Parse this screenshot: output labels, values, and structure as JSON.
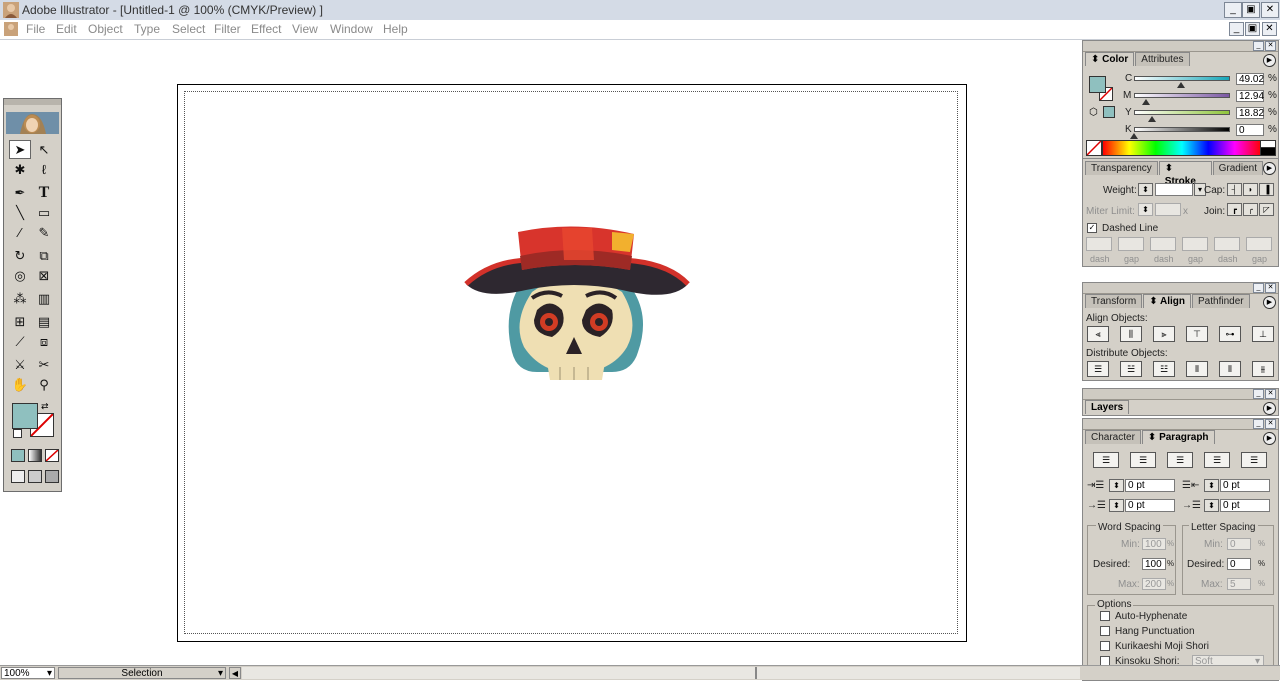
{
  "window": {
    "title": "Adobe Illustrator - [Untitled-1 @ 100% (CMYK/Preview) ]",
    "minimize": "_",
    "restore": "▣",
    "close": "✕"
  },
  "menu": [
    "File",
    "Edit",
    "Object",
    "Type",
    "Select",
    "Filter",
    "Effect",
    "View",
    "Window",
    "Help"
  ],
  "color_palette": {
    "tabs": [
      "Color",
      "Attributes"
    ],
    "active_tab": "Color",
    "channels": [
      {
        "label": "C",
        "value": "49.02",
        "unit": "%",
        "level": 0.49,
        "gradient_end": "#16a6b8"
      },
      {
        "label": "M",
        "value": "12.94",
        "unit": "%",
        "level": 0.13,
        "gradient_end": "#7b57a3"
      },
      {
        "label": "Y",
        "value": "18.82",
        "unit": "%",
        "level": 0.19,
        "gradient_end": "#8fc43b"
      },
      {
        "label": "K",
        "value": "0",
        "unit": "%",
        "level": 0.0,
        "gradient_end": "#000000"
      }
    ],
    "fill_color": "#8fc0bf"
  },
  "stroke_palette": {
    "tabs": [
      "Transparency",
      "Stroke",
      "Gradient"
    ],
    "active_tab": "Stroke",
    "weight_label": "Weight:",
    "cap_label": "Cap:",
    "miter_label": "Miter Limit:",
    "miter_unit": "x",
    "join_label": "Join:",
    "dashed_label": "Dashed Line",
    "dash_labels": [
      "dash",
      "gap",
      "dash",
      "gap",
      "dash",
      "gap"
    ]
  },
  "align_palette": {
    "tabs": [
      "Transform",
      "Align",
      "Pathfinder"
    ],
    "active_tab": "Align",
    "align_label": "Align Objects:",
    "distribute_label": "Distribute Objects:"
  },
  "layers_palette": {
    "title": "Layers"
  },
  "paragraph_palette": {
    "tabs": [
      "Character",
      "Paragraph"
    ],
    "active_tab": "Paragraph",
    "indents": [
      {
        "name": "left-indent",
        "value": "0 pt"
      },
      {
        "name": "right-indent",
        "value": "0 pt"
      },
      {
        "name": "first-line-indent",
        "value": "0 pt"
      },
      {
        "name": "space-before",
        "value": "0 pt"
      }
    ],
    "word_spacing": {
      "title": "Word Spacing",
      "min_label": "Min:",
      "min": "100",
      "desired_label": "Desired:",
      "desired": "100",
      "max_label": "Max:",
      "max": "200",
      "unit": "%"
    },
    "letter_spacing": {
      "title": "Letter Spacing",
      "min_label": "Min:",
      "min": "0",
      "desired_label": "Desired:",
      "desired": "0",
      "max_label": "Max:",
      "max": "5",
      "unit": "%"
    },
    "options_title": "Options",
    "options": [
      "Auto-Hyphenate",
      "Hang Punctuation",
      "Kurikaeshi Moji Shori",
      "Kinsoku Shori:"
    ],
    "kinsoku_value": "Soft"
  },
  "status": {
    "zoom": "100%",
    "tool": "Selection"
  }
}
